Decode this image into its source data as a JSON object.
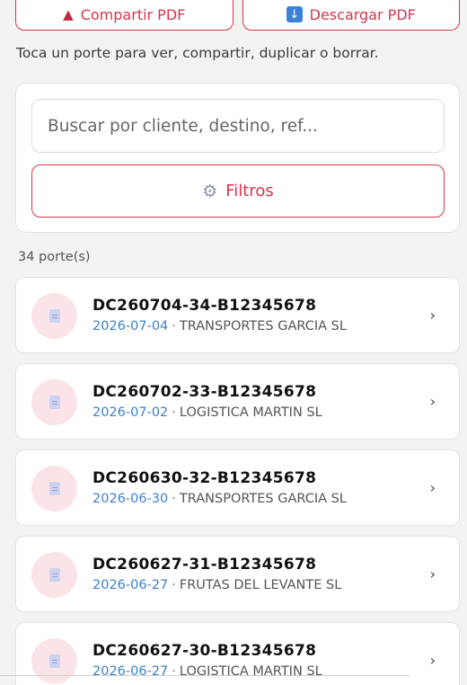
{
  "actions": {
    "share_label": "Compartir PDF",
    "download_label": "Descargar PDF"
  },
  "hint": "Toca un porte para ver, compartir, duplicar o borrar.",
  "search": {
    "placeholder": "Buscar por cliente, destino, ref...",
    "value": ""
  },
  "filters_label": "Filtros",
  "count_label": "34 porte(s)",
  "items": [
    {
      "ref": "DC260704-34-B12345678",
      "date": "2026-07-04",
      "client": "TRANSPORTES GARCIA SL"
    },
    {
      "ref": "DC260702-33-B12345678",
      "date": "2026-07-02",
      "client": "LOGISTICA MARTIN SL"
    },
    {
      "ref": "DC260630-32-B12345678",
      "date": "2026-06-30",
      "client": "TRANSPORTES GARCIA SL"
    },
    {
      "ref": "DC260627-31-B12345678",
      "date": "2026-06-27",
      "client": "FRUTAS DEL LEVANTE SL"
    },
    {
      "ref": "DC260627-30-B12345678",
      "date": "2026-06-27",
      "client": "LOGISTICA MARTIN SL"
    }
  ],
  "separator": "·",
  "colors": {
    "accent": "#d4354c",
    "date": "#3d82c8",
    "avatar_bg": "#fbe4e8"
  },
  "icons": {
    "share": "share-icon",
    "download": "download-icon",
    "filter": "gear-icon",
    "item": "document-icon",
    "chevron": "chevron-right-icon"
  }
}
